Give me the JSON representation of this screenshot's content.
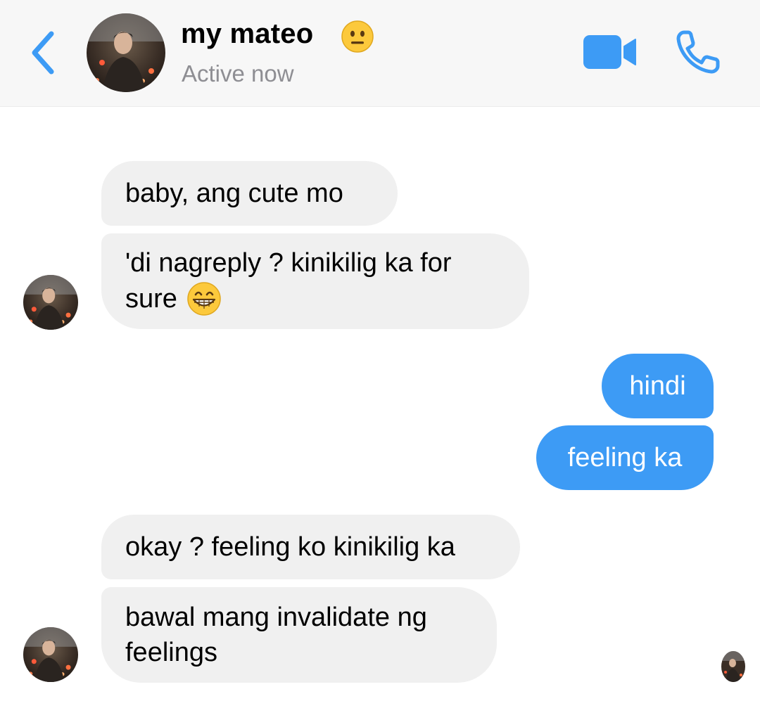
{
  "header": {
    "contact_name": "my mateo",
    "name_emoji": "neutral-face-emoji",
    "status": "Active now",
    "back_icon": "chevron-left-icon",
    "video_icon": "video-camera-icon",
    "call_icon": "phone-icon"
  },
  "messages": [
    {
      "direction": "incoming",
      "text": "baby, ang cute mo"
    },
    {
      "direction": "incoming",
      "line1": "'di nagreply ? kinikilig ka for",
      "line2": "sure",
      "emoji": "grinning-face-emoji"
    },
    {
      "direction": "outgoing",
      "text": "hindi"
    },
    {
      "direction": "outgoing",
      "text": "feeling ka"
    },
    {
      "direction": "incoming",
      "text": "okay ? feeling ko kinikilig ka"
    },
    {
      "direction": "incoming",
      "line1": "bawal mang invalidate ng",
      "line2": "feelings"
    }
  ],
  "colors": {
    "accent": "#3d9bf5",
    "incoming_bubble": "#f0f0f0",
    "header_bg": "#f7f7f7",
    "status_text": "#8e8e93"
  }
}
